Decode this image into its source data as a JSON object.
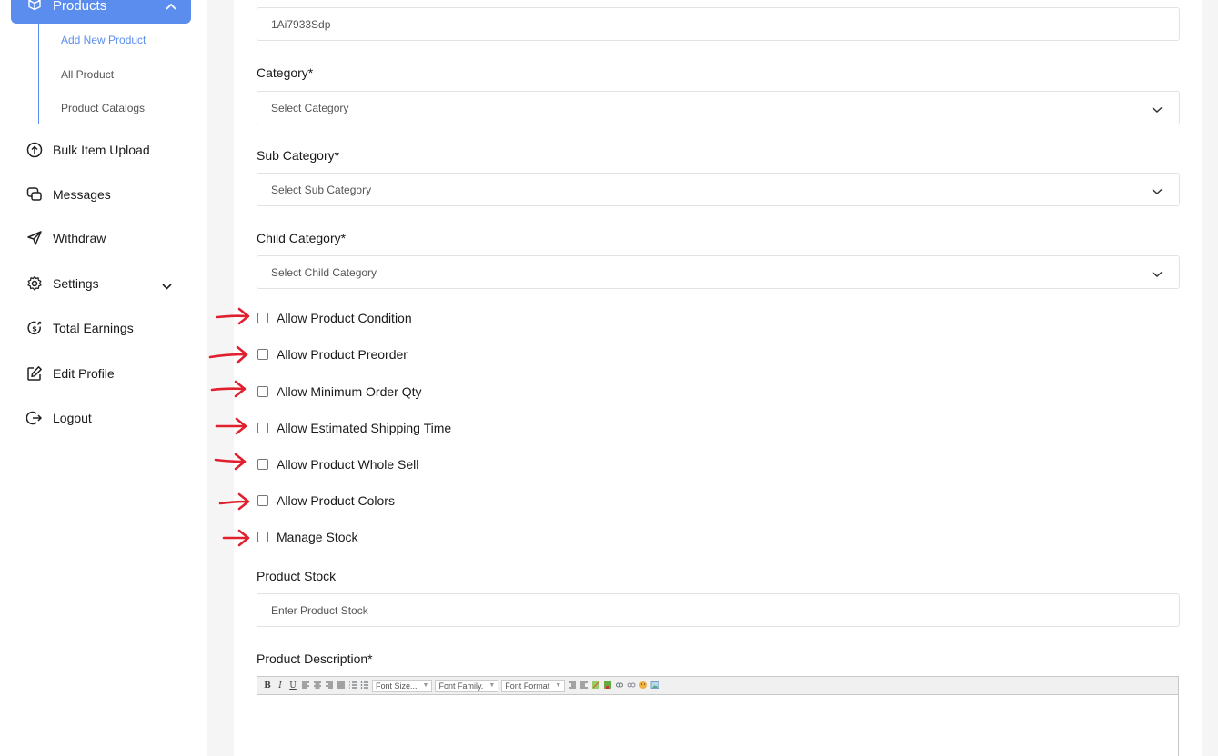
{
  "sidebar": {
    "active": {
      "label": "Products",
      "icon": "box-icon"
    },
    "subitems": [
      {
        "label": "Add New Product",
        "active": true
      },
      {
        "label": "All Product",
        "active": false
      },
      {
        "label": "Product Catalogs",
        "active": false
      }
    ],
    "items": [
      {
        "label": "Bulk Item Upload",
        "icon": "upload-icon"
      },
      {
        "label": "Messages",
        "icon": "chat-icon"
      },
      {
        "label": "Withdraw",
        "icon": "send-icon"
      },
      {
        "label": "Settings",
        "icon": "gear-icon"
      },
      {
        "label": "Total Earnings",
        "icon": "earnings-icon"
      },
      {
        "label": "Edit Profile",
        "icon": "edit-icon"
      },
      {
        "label": "Logout",
        "icon": "logout-icon"
      }
    ]
  },
  "form": {
    "sku_value": "1Ai7933Sdp",
    "category": {
      "label": "Category*",
      "placeholder": "Select Category"
    },
    "sub_category": {
      "label": "Sub Category*",
      "placeholder": "Select Sub Category"
    },
    "child_category": {
      "label": "Child Category*",
      "placeholder": "Select Child Category"
    },
    "checkboxes": [
      {
        "label": "Allow Product Condition",
        "checked": false
      },
      {
        "label": "Allow Product Preorder",
        "checked": false
      },
      {
        "label": "Allow Minimum Order Qty",
        "checked": false
      },
      {
        "label": "Allow Estimated Shipping Time",
        "checked": false
      },
      {
        "label": "Allow Product Whole Sell",
        "checked": false
      },
      {
        "label": "Allow Product Colors",
        "checked": false
      },
      {
        "label": "Manage Stock",
        "checked": false
      }
    ],
    "stock": {
      "label": "Product Stock",
      "placeholder": "Enter Product Stock"
    },
    "description": {
      "label": "Product Description*",
      "toolbar": {
        "buttons": [
          "B",
          "I",
          "U"
        ],
        "font_size": "Font Size...",
        "font_family": "Font Family.",
        "font_format": "Font Format"
      }
    }
  },
  "colors": {
    "accent": "#5b8def",
    "annotation": "#e0202f"
  }
}
